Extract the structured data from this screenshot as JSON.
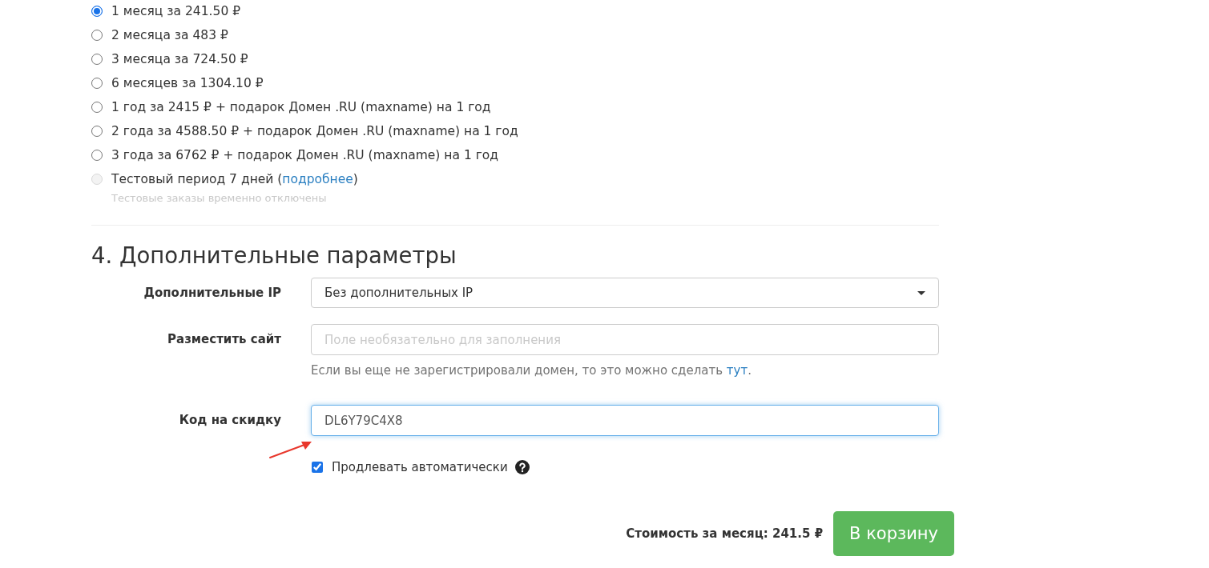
{
  "periods": [
    {
      "label": "1 месяц за 241.50 ₽",
      "selected": true,
      "disabled": false
    },
    {
      "label": "2 месяца за 483 ₽",
      "selected": false,
      "disabled": false
    },
    {
      "label": "3 месяца за 724.50 ₽",
      "selected": false,
      "disabled": false
    },
    {
      "label": "6 месяцев за 1304.10 ₽",
      "selected": false,
      "disabled": false
    },
    {
      "label": "1 год за 2415 ₽ + подарок Домен .RU (maxname) на 1 год",
      "selected": false,
      "disabled": false
    },
    {
      "label": "2 года за 4588.50 ₽ + подарок Домен .RU (maxname) на 1 год",
      "selected": false,
      "disabled": false
    },
    {
      "label": "3 года за 6762 ₽ + подарок Домен .RU (maxname) на 1 год",
      "selected": false,
      "disabled": false
    },
    {
      "label": "Тестовый период 7 дней (",
      "link": "подробнее",
      "label_after": ")",
      "note": "Тестовые заказы временно отключены",
      "selected": false,
      "disabled": true
    }
  ],
  "section": {
    "title": "4. Дополнительные параметры",
    "fields": [
      {
        "kind": "select",
        "label": "Дополнительные IP",
        "value": "Без дополнительных IP",
        "focused": false
      },
      {
        "kind": "text",
        "label": "Разместить сайт",
        "placeholder": "Поле необязательно для заполнения",
        "focused": false,
        "help": "Если вы еще не зарегистрировали домен, то это можно сделать ",
        "help_link": "тут",
        "help_after": "."
      },
      {
        "kind": "text",
        "label": "Код на скидку",
        "value": "DL6Y79C4X8",
        "focused": true
      }
    ],
    "auto_renew": {
      "label": "Продлевать автоматически",
      "checked": true
    }
  },
  "total": {
    "label": "Стоимость за месяц: 241.5 ₽",
    "button": "В корзину"
  }
}
